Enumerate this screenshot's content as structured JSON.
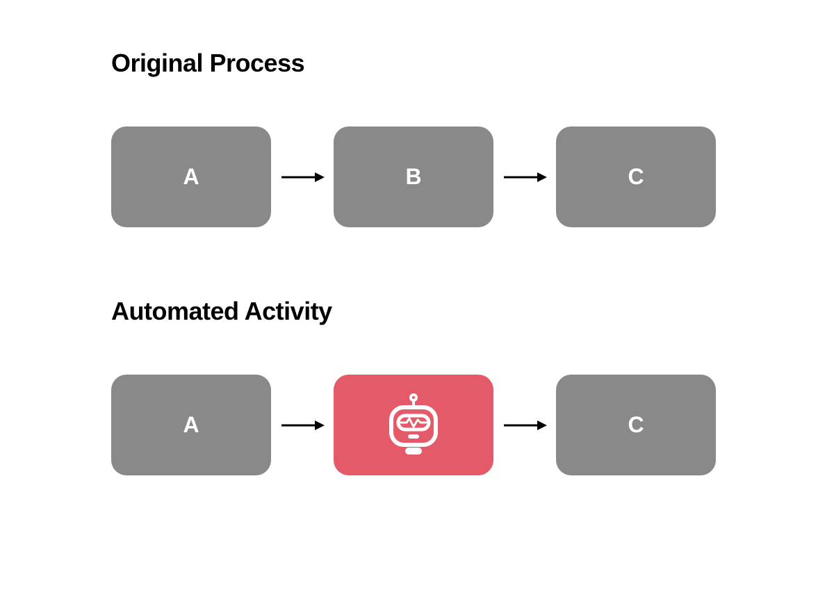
{
  "sections": {
    "original": {
      "title": "Original Process",
      "steps": {
        "a": "A",
        "b": "B",
        "c": "C"
      }
    },
    "automated": {
      "title": "Automated Activity",
      "steps": {
        "a": "A",
        "c": "C"
      },
      "robot_icon": "robot"
    }
  },
  "colors": {
    "box_gray": "#898989",
    "box_red": "#e45a68",
    "text_white": "#ffffff",
    "title_black": "#000000"
  }
}
